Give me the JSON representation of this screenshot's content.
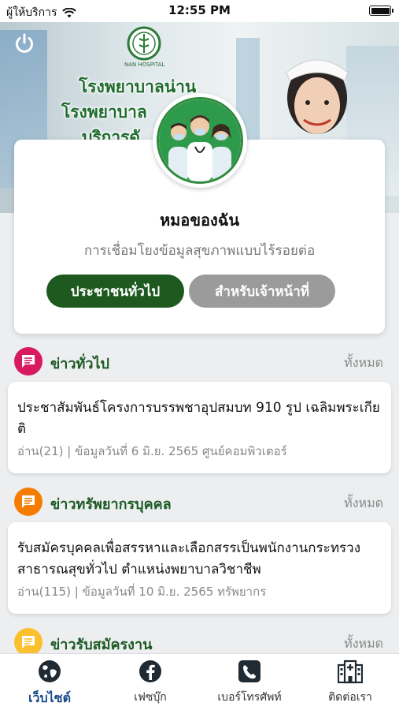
{
  "status_bar": {
    "carrier": "ผู้ให้บริการ",
    "time": "12:55 PM"
  },
  "hero": {
    "logo_caption": "NAN HOSPITAL",
    "lines": [
      "โรงพยาบาลน่าน",
      "โรงพยาบาล",
      "บริการดั"
    ]
  },
  "card": {
    "title": "หมอของฉัน",
    "subtitle": "การเชื่อมโยงข้อมูลสุขภาพแบบไร้รอยต่อ",
    "btn_public": "ประชาชนทั่วไป",
    "btn_staff": "สำหรับเจ้าหน้าที่"
  },
  "colors": {
    "primary": "#1e5a1f",
    "secondary": "#9b9b9b",
    "news_general": "#d81b60",
    "news_hr": "#f57c00",
    "news_jobs": "#fbc02d"
  },
  "sections": [
    {
      "title": "ข่าวทั่วไป",
      "all": "ทั้งหมด",
      "headline": "ประชาสัมพันธ์โครงการบรรพชาอุปสมบท 910 รูป เฉลิมพระเกียติ",
      "meta": "อ่าน(21) | ข้อมูลวันที่ 6 มิ.ย. 2565 ศูนย์คอมพิวเตอร์"
    },
    {
      "title": "ข่าวทรัพยากรบุคคล",
      "all": "ทั้งหมด",
      "headline": "รับสมัครบุคคลเพื่อสรรหาและเลือกสรรเป็นพนักงานกระทรวงสาธารณสุขทั่วไป ตำแหน่งพยาบาลวิชาชีพ",
      "meta": "อ่าน(115) | ข้อมูลวันที่ 10 มิ.ย. 2565 ทรัพยากร"
    },
    {
      "title": "ข่าวรับสมัครงาน",
      "all": "ทั้งหมด"
    }
  ],
  "tabs": [
    {
      "label": "เว็บไซต์",
      "icon": "globe-icon",
      "active": true
    },
    {
      "label": "เฟซบุ๊ก",
      "icon": "facebook-icon",
      "active": false
    },
    {
      "label": "เบอร์โทรศัพท์",
      "icon": "phone-icon",
      "active": false
    },
    {
      "label": "ติดต่อเรา",
      "icon": "hospital-icon",
      "active": false
    }
  ]
}
